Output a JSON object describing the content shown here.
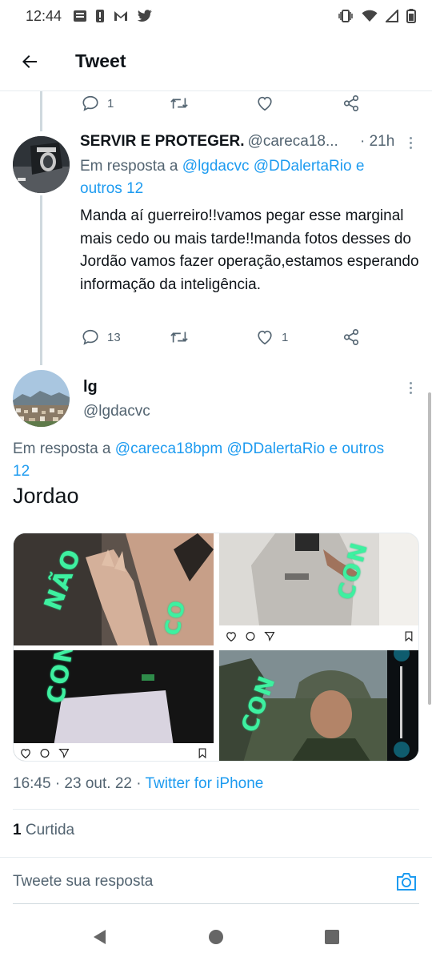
{
  "status_bar": {
    "time": "12:44"
  },
  "header": {
    "title": "Tweet"
  },
  "previous_tweet_actions": {
    "reply_count": "1",
    "retweet_count": "",
    "like_count": ""
  },
  "reply_tweet": {
    "display_name": "SERVIR E PROTEGER.",
    "handle": "@careca18...",
    "time": "· 21h",
    "in_reply_prefix": "Em resposta a",
    "in_reply_links": "@lgdacvc @DDalertaRio e",
    "in_reply_more": "outros 12",
    "text": "Manda aí guerreiro!!vamos pegar esse marginal mais cedo ou mais tarde!!manda fotos desses do Jordão vamos fazer operação,estamos esperando informação da inteligência.",
    "reply_count": "13",
    "retweet_count": "",
    "like_count": "1"
  },
  "main_tweet": {
    "display_name": "lg",
    "handle": "@lgdacvc",
    "in_reply_prefix": "Em resposta a",
    "in_reply_links": "@careca18bpm @DDalertaRio e outros",
    "in_reply_more": "12",
    "text": "Jordao",
    "timestamp": "16:45 · 23 out. 22 ·",
    "source": "Twitter for iPhone",
    "likes_count": "1",
    "likes_label": "Curtida"
  },
  "compose": {
    "placeholder": "Tweete sua resposta"
  },
  "colors": {
    "link": "#1d9bf0",
    "secondary_text": "#536471",
    "primary_text": "#0f1419",
    "neon_overlay": "#3ef0a0"
  },
  "icons": [
    "back-arrow-icon",
    "reply-icon",
    "retweet-icon",
    "like-icon",
    "share-icon",
    "more-icon",
    "camera-icon",
    "nav-back-icon",
    "nav-home-icon",
    "nav-recents-icon"
  ]
}
